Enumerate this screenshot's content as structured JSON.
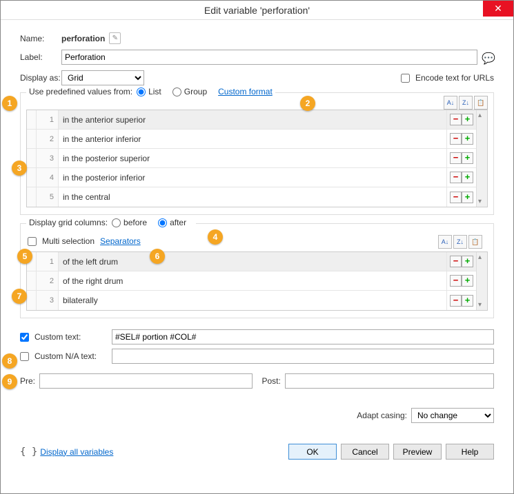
{
  "title": "Edit variable 'perforation'",
  "name_label": "Name:",
  "name_value": "perforation",
  "label_label": "Label:",
  "label_value": "Perforation",
  "display_as_label": "Display as:",
  "display_as_value": "Grid",
  "encode_label": "Encode text for URLs",
  "predef_legend": "Use predefined values from:",
  "radio_list": "List",
  "radio_group": "Group",
  "custom_format_link": "Custom format",
  "list1": [
    {
      "n": "1",
      "v": "in the anterior superior"
    },
    {
      "n": "2",
      "v": "in the anterior inferior"
    },
    {
      "n": "3",
      "v": "in the posterior superior"
    },
    {
      "n": "4",
      "v": "in the posterior inferior"
    },
    {
      "n": "5",
      "v": "in the central"
    }
  ],
  "grid_cols_legend": "Display grid columns:",
  "radio_before": "before",
  "radio_after": "after",
  "multi_sel_label": "Multi selection",
  "separators_link": "Separators",
  "list2": [
    {
      "n": "1",
      "v": "of the left drum"
    },
    {
      "n": "2",
      "v": "of the right drum"
    },
    {
      "n": "3",
      "v": "bilaterally"
    }
  ],
  "custom_text_label": "Custom text:",
  "custom_text_value": "#SEL# portion #COL#",
  "custom_na_label": "Custom N/A text:",
  "custom_na_value": "",
  "pre_label": "Pre:",
  "pre_value": "",
  "post_label": "Post:",
  "post_value": "",
  "casing_label": "Adapt casing:",
  "casing_value": "No change",
  "display_all_vars": "Display all variables",
  "btn_ok": "OK",
  "btn_cancel": "Cancel",
  "btn_preview": "Preview",
  "btn_help": "Help",
  "sort_az": "A↓",
  "sort_za": "Z↓",
  "callouts": [
    "1",
    "2",
    "3",
    "4",
    "5",
    "6",
    "7",
    "8",
    "9"
  ]
}
